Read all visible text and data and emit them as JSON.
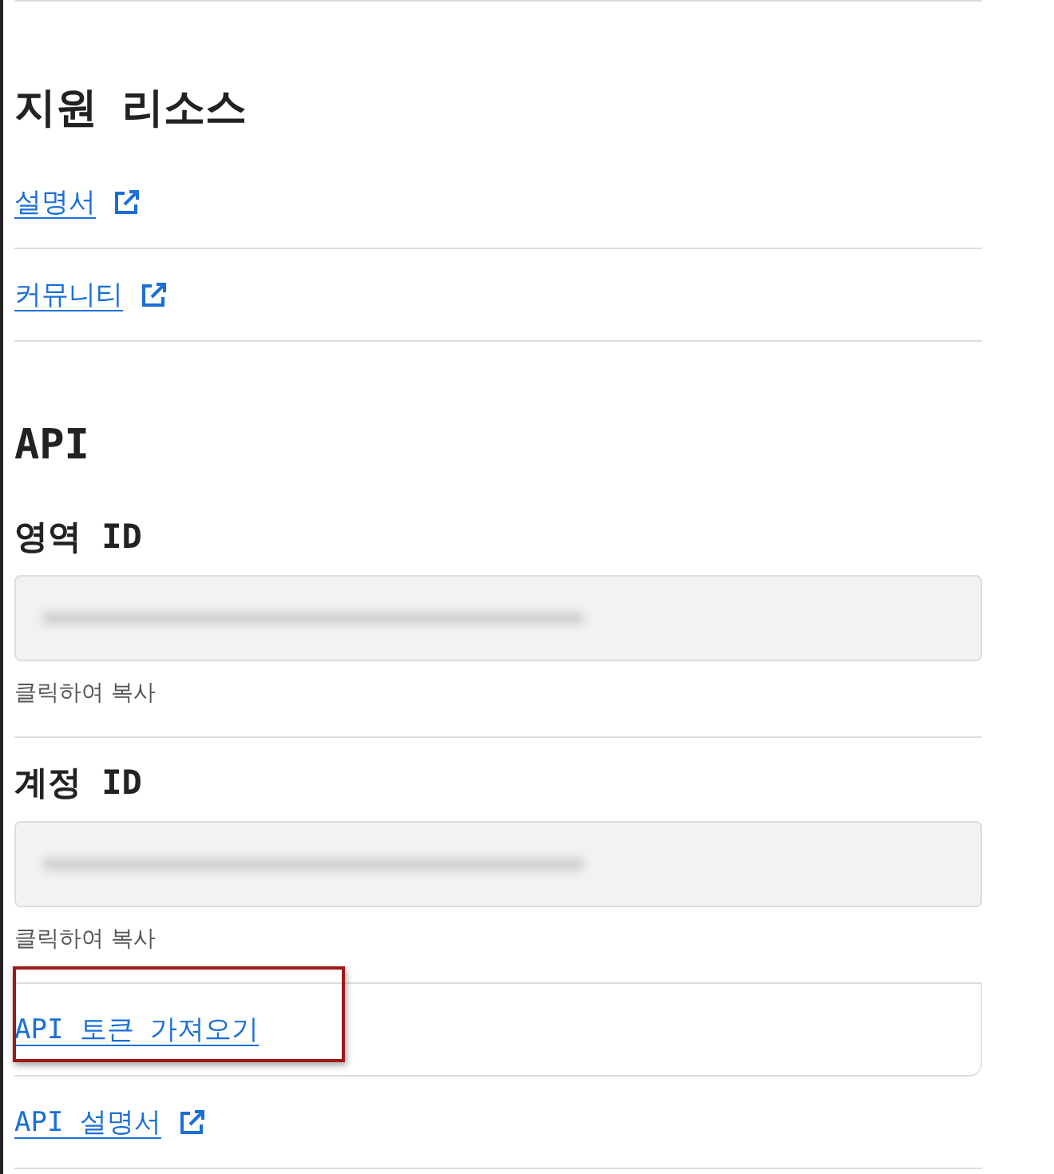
{
  "support_resources": {
    "title": "지원 리소스",
    "links": [
      {
        "label": "설명서",
        "external": true
      },
      {
        "label": "커뮤니티",
        "external": true
      }
    ]
  },
  "api": {
    "title": "API",
    "fields": [
      {
        "label": "영역 ID",
        "hint": "클릭하여 복사"
      },
      {
        "label": "계정 ID",
        "hint": "클릭하여 복사"
      }
    ],
    "links": [
      {
        "label": "API 토큰 가져오기",
        "external": false,
        "highlighted": true
      },
      {
        "label": "API 설명서",
        "external": true,
        "highlighted": false
      }
    ]
  }
}
